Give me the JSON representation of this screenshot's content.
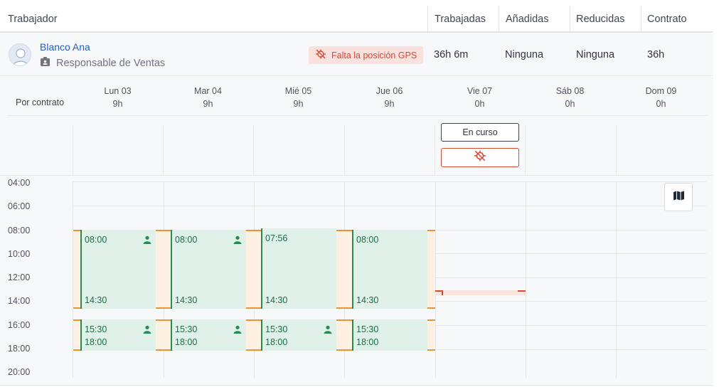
{
  "header": {
    "col_worker": "Trabajador",
    "col_worked": "Trabajadas",
    "col_added": "Añadidas",
    "col_reduced": "Reducidas",
    "col_contract": "Contrato"
  },
  "worker": {
    "name": "Blanco Ana",
    "role": "Responsable de Ventas",
    "gps_warning": "Falta la posición GPS",
    "worked": "36h 6m",
    "added": "Ninguna",
    "reduced": "Ninguna",
    "contract": "36h"
  },
  "schedule": {
    "row_label": "Por contrato",
    "days": [
      {
        "name": "Lun 03",
        "hours": "9h"
      },
      {
        "name": "Mar 04",
        "hours": "9h"
      },
      {
        "name": "Mié 05",
        "hours": "9h"
      },
      {
        "name": "Jue 06",
        "hours": "9h"
      },
      {
        "name": "Vie 07",
        "hours": "0h"
      },
      {
        "name": "Sáb 08",
        "hours": "0h"
      },
      {
        "name": "Dom 09",
        "hours": "0h"
      }
    ],
    "in_progress_label": "En curso"
  },
  "time_labels": [
    "04:00",
    "06:00",
    "08:00",
    "10:00",
    "12:00",
    "14:00",
    "16:00",
    "18:00",
    "20:00"
  ],
  "shifts": [
    {
      "day": "Lun 03",
      "start": "08:00",
      "end": "14:30",
      "person_icon": true
    },
    {
      "day": "Mar 04",
      "start": "08:00",
      "end": "14:30",
      "person_icon": true
    },
    {
      "day": "Mié 05",
      "start": "07:56",
      "end": "14:30",
      "person_icon": false
    },
    {
      "day": "Jue 06",
      "start": "08:00",
      "end": "14:30",
      "person_icon": false
    },
    {
      "day": "Lun 03",
      "start": "15:30",
      "end": "18:00",
      "person_icon": true
    },
    {
      "day": "Mar 04",
      "start": "15:30",
      "end": "18:00",
      "person_icon": true
    },
    {
      "day": "Mié 05",
      "start": "15:30",
      "end": "18:00",
      "person_icon": true
    },
    {
      "day": "Jue 06",
      "start": "15:30",
      "end": "18:00",
      "person_icon": false
    }
  ],
  "colors": {
    "accent_blue": "#2160c4",
    "shift_green": "#2a8a57",
    "shift_fill": "#dff1e8",
    "warning_red": "#d84a31",
    "warning_fill": "#fbe1dd",
    "overtime_orange": "#f0922e"
  },
  "icons": {
    "gps_off": "gps-off-icon",
    "role": "id-badge-icon",
    "person": "person-icon",
    "map": "map-icon"
  }
}
